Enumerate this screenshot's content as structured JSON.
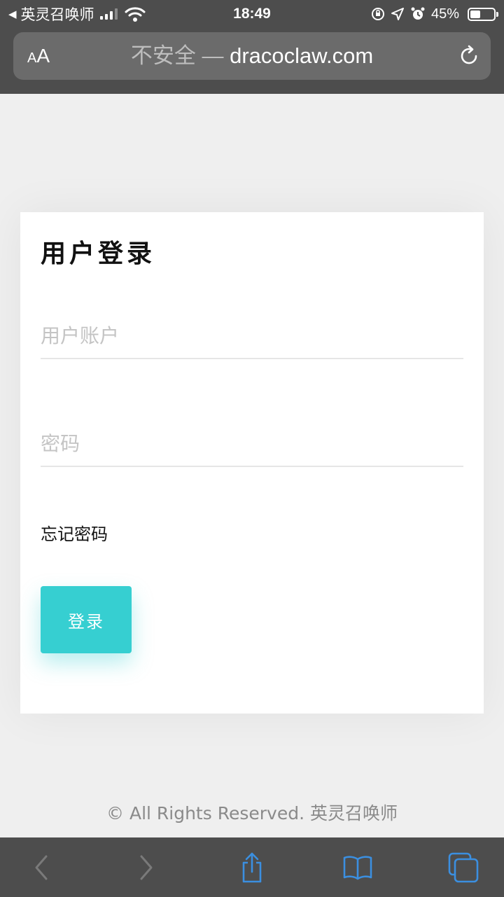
{
  "status_bar": {
    "back_app": "英灵召唤师",
    "time": "18:49",
    "battery_percent": "45%",
    "battery_level": 0.45,
    "icons": [
      "signal-icon",
      "wifi-icon",
      "orientation-lock-icon",
      "location-icon",
      "alarm-icon",
      "battery-icon"
    ]
  },
  "browser": {
    "text_size_label": "AA",
    "url_security": "不安全",
    "url_separator": "—",
    "url_domain": "dracoclaw.com",
    "toolbar_icons": [
      "back-icon",
      "forward-icon",
      "share-icon",
      "bookmarks-icon",
      "tabs-icon"
    ]
  },
  "login": {
    "title": "用户登录",
    "account_placeholder": "用户账户",
    "account_value": "",
    "password_placeholder": "密码",
    "password_value": "",
    "forgot_label": "忘记密码",
    "submit_label": "登录"
  },
  "footer": {
    "text": "© All Rights Reserved. 英灵召唤师"
  },
  "colors": {
    "chrome": "#4d4d4d",
    "url_field": "#6b6b6b",
    "page_bg": "#efefef",
    "card_bg": "#ffffff",
    "accent": "#36cfd1",
    "toolbar_icon_active": "#3b8fe0",
    "toolbar_icon_disabled": "#7a7a7a"
  }
}
